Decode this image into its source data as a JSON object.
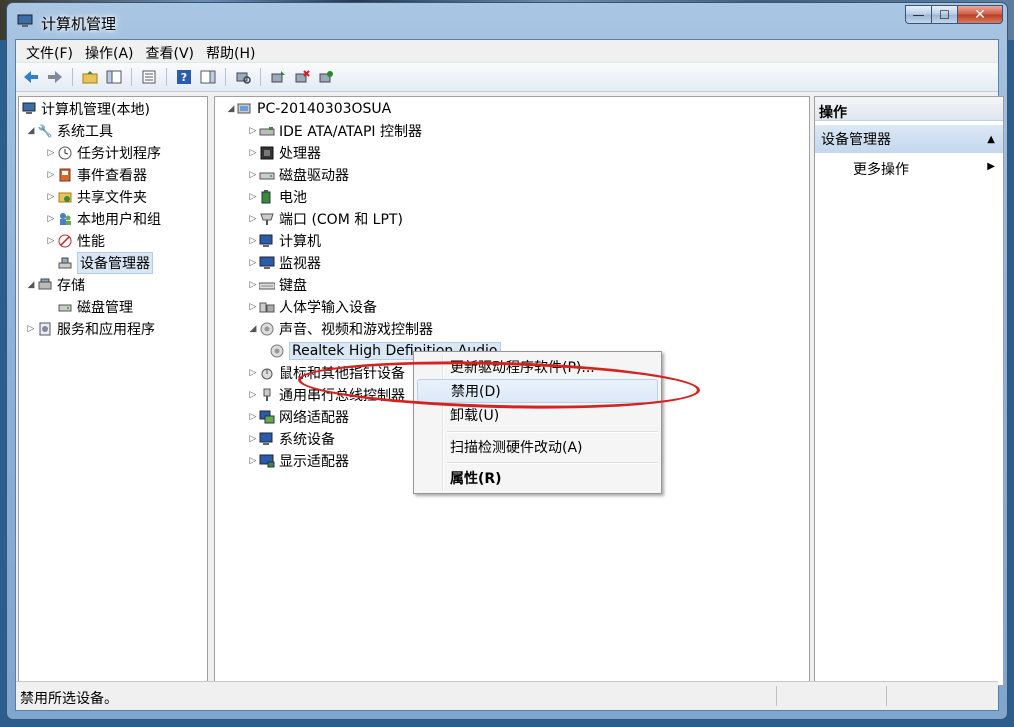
{
  "window": {
    "title": "计算机管理",
    "minimize": "—",
    "maximize": "☐",
    "close": "✕"
  },
  "menubar": [
    "文件(F)",
    "操作(A)",
    "查看(V)",
    "帮助(H)"
  ],
  "left_tree": {
    "root": "计算机管理(本地)",
    "items": [
      {
        "label": "系统工具",
        "icon": "tools-icon"
      },
      {
        "label": "任务计划程序",
        "icon": "clock-icon"
      },
      {
        "label": "事件查看器",
        "icon": "event-viewer-icon"
      },
      {
        "label": "共享文件夹",
        "icon": "shared-folder-icon"
      },
      {
        "label": "本地用户和组",
        "icon": "users-icon"
      },
      {
        "label": "性能",
        "icon": "performance-icon"
      },
      {
        "label": "设备管理器",
        "icon": "device-manager-icon"
      },
      {
        "label": "存储",
        "icon": "storage-icon"
      },
      {
        "label": "磁盘管理",
        "icon": "disk-icon"
      },
      {
        "label": "服务和应用程序",
        "icon": "services-icon"
      }
    ]
  },
  "device_tree": {
    "root": "PC-20140303OSUA",
    "categories": [
      "IDE ATA/ATAPI 控制器",
      "处理器",
      "磁盘驱动器",
      "电池",
      "端口 (COM 和 LPT)",
      "计算机",
      "监视器",
      "键盘",
      "人体学输入设备",
      "声音、视频和游戏控制器",
      "鼠标和其他指针设备",
      "通用串行总线控制器",
      "网络适配器",
      "系统设备",
      "显示适配器"
    ],
    "selected_device": "Realtek High Definition Audio"
  },
  "context_menu": {
    "items": [
      "更新驱动程序软件(P)...",
      "禁用(D)",
      "卸载(U)",
      "扫描检测硬件改动(A)",
      "属性(R)"
    ]
  },
  "actions_pane": {
    "header": "操作",
    "group": "设备管理器",
    "more": "更多操作"
  },
  "statusbar": {
    "text": "禁用所选设备。"
  },
  "colors": {
    "highlight_ellipse": "#d4231f",
    "selection": "#d9e6f4"
  }
}
